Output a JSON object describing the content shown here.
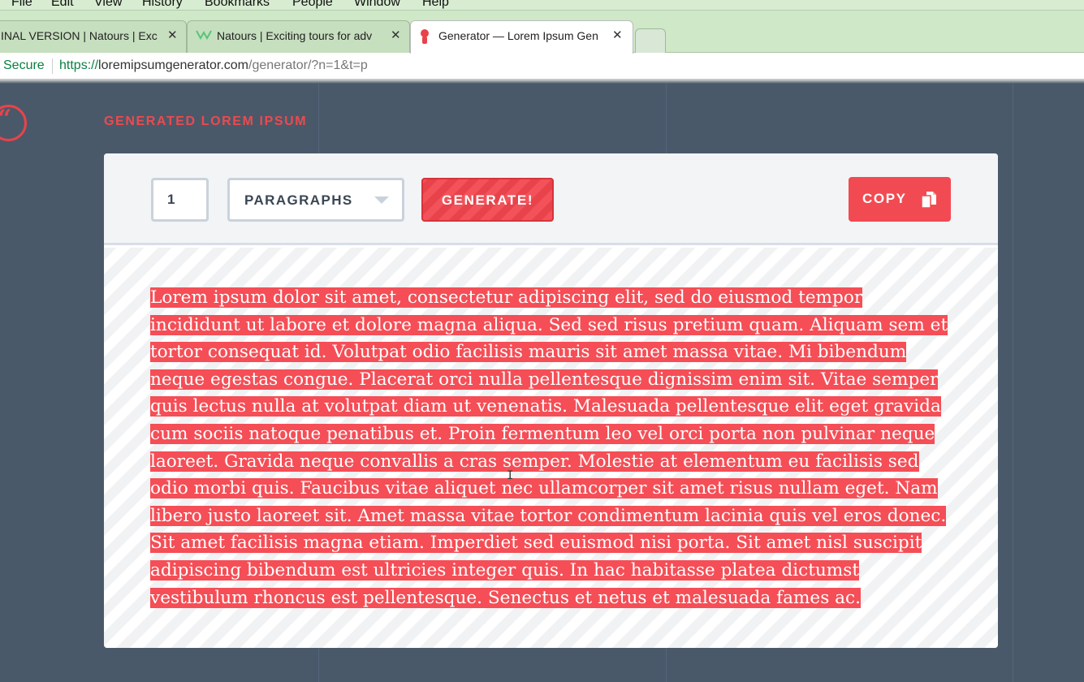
{
  "menubar": {
    "items": [
      "File",
      "Edit",
      "View",
      "History",
      "Bookmarks",
      "People",
      "Window",
      "Help"
    ]
  },
  "tabs": [
    {
      "title": "INAL VERSION | Natours | Exc",
      "active": false
    },
    {
      "title": "Natours | Exciting tours for adv",
      "active": false
    },
    {
      "title": "Generator — Lorem Ipsum Gen",
      "active": true
    }
  ],
  "address_bar": {
    "secure_label": "Secure",
    "url_scheme": "https://",
    "url_host": "loremipsumgenerator.com",
    "url_path": "/generator/?n=1&t=p"
  },
  "page": {
    "section_title": "GENERATED LOREM IPSUM",
    "quote_glyph": "“"
  },
  "toolbar": {
    "count_value": "1",
    "type_value": "PARAGRAPHS",
    "generate_label": "GENERATE!",
    "copy_label": "COPY"
  },
  "output": {
    "text": "Lorem ipsum dolor sit amet, consectetur adipiscing elit, sed do eiusmod tempor incididunt ut labore et dolore magna aliqua. Sed sed risus pretium quam. Aliquam sem et tortor consequat id. Volutpat odio facilisis mauris sit amet massa vitae. Mi bibendum neque egestas congue. Placerat orci nulla pellentesque dignissim enim sit. Vitae semper quis lectus nulla at volutpat diam ut venenatis. Malesuada pellentesque elit eget gravida cum sociis natoque penatibus et. Proin fermentum leo vel orci porta non pulvinar neque laoreet. Gravida neque convallis a cras semper. Molestie at elementum eu facilisis sed odio morbi quis. Faucibus vitae aliquet nec ullamcorper sit amet risus nullam eget. Nam libero justo laoreet sit. Amet massa vitae tortor condimentum lacinia quis vel eros donec. Sit amet facilisis magna etiam. Imperdiet sed euismod nisi porta. Sit amet nisl suscipit adipiscing bibendum est ultricies integer quis. In hac habitasse platea dictumst vestibulum rhoncus est pellentesque. Senectus et netus et malesuada fames ac.",
    "selected": true
  },
  "colors": {
    "accent": "#f24a52",
    "page_bg": "#4a5969",
    "selection": "#f54e56",
    "secure_green": "#0b8043"
  }
}
